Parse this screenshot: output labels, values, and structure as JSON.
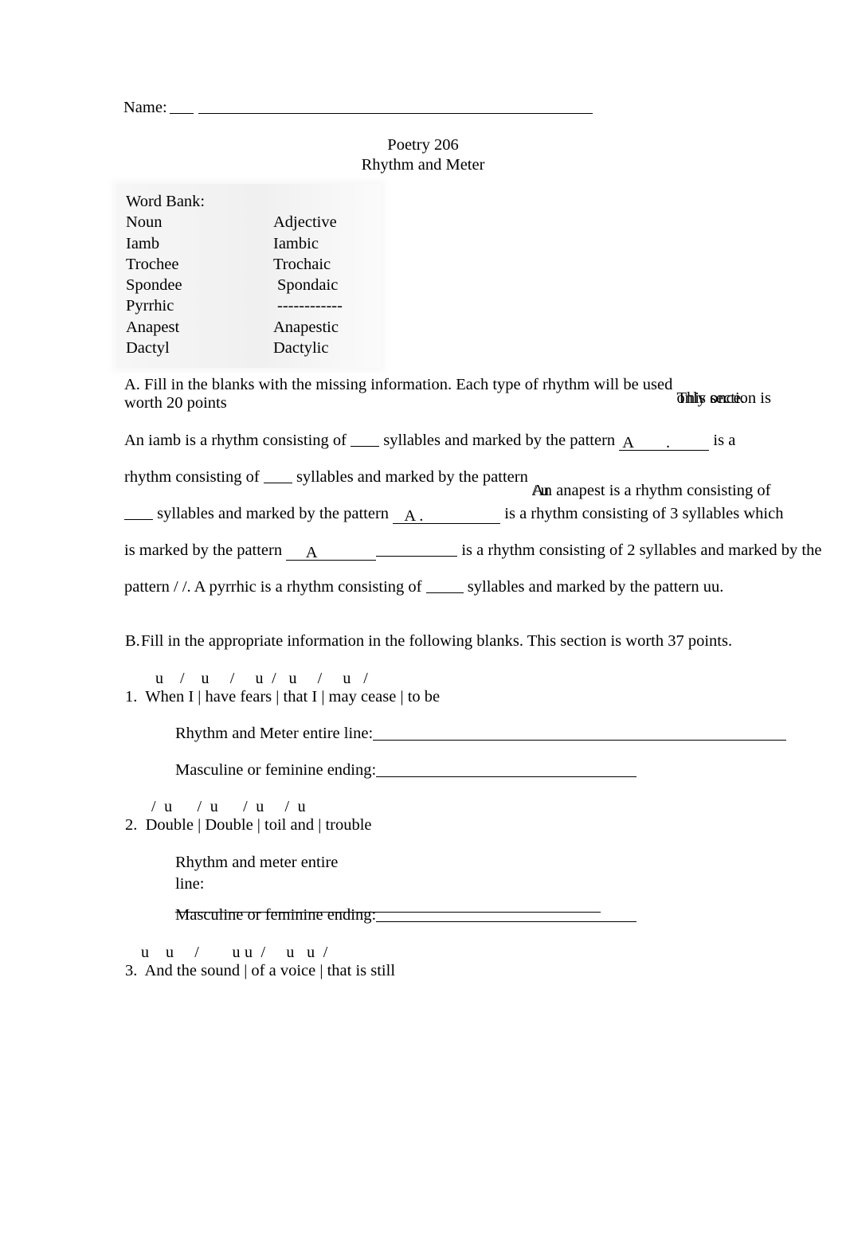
{
  "document": {
    "name_label": "Name:",
    "title_line1": "Poetry 206",
    "title_line2": "Rhythm and Meter"
  },
  "word_bank": {
    "heading": "Word Bank:",
    "rows": [
      {
        "noun": "Noun",
        "adjective": "Adjective"
      },
      {
        "noun": "Iamb",
        "adjective": "Iambic"
      },
      {
        "noun": "Trochee",
        "adjective": "Trochaic"
      },
      {
        "noun": "Spondee",
        "adjective": "Spondaic"
      },
      {
        "noun": "Pyrrhic",
        "adjective": "------------"
      },
      {
        "noun": "Anapest",
        "adjective": "Anapestic"
      },
      {
        "noun": "Dactyl",
        "adjective": "Dactylic"
      }
    ]
  },
  "section_a": {
    "instructions_part1": "A.  Fill in the blanks with the missing information. Each type of rhythm will be used ",
    "instructions_overlap_a": "only once.",
    "instructions_overlap_b": "This section is",
    "instructions_part2": "worth 20 points",
    "line1_t1": "An iamb is a rhythm consisting of ",
    "line1_t2": " syllables and marked by the pattern ",
    "line1_answer": " A        .",
    "line1_t3": " is a",
    "line2_t1": "rhythm consisting of ",
    "line2_t2": " syllables and marked by the pattern ",
    "line2_overlap_a": "/ u",
    "line2_overlap_b": "An anapest is a rhythm consisting of",
    "line3_t1": " syllables and marked by the pattern ",
    "line3_answer": "   A .",
    "line3_t2": " is a rhythm consisting of 3 syllables which",
    "line4_t1": "is marked by the pattern ",
    "line4_answer": "     A",
    "line4_t2": " is a rhythm consisting of 2 syllables and marked by the",
    "line5_t1": "pattern / /. A pyrrhic is a rhythm consisting of ",
    "line5_t2": " syllables and marked by the pattern uu."
  },
  "section_b": {
    "letter": "B.",
    "instructions": "Fill in the appropriate information in the following blanks. This section is worth 37 points.",
    "items": [
      {
        "scansion": "u    /    u     /     u  /   u     /     u   /",
        "text": "1.  When I | have fears | that I | may cease | to be",
        "prompt_rhythm": "Rhythm and Meter entire line:",
        "prompt_ending": "Masculine or feminine ending:"
      },
      {
        "scansion": "/  u      /  u      /  u     /  u",
        "text": "2.  Double | Double | toil and | trouble",
        "prompt_rhythm_line1": "Rhythm and meter entire",
        "prompt_rhythm_line2": "line:",
        "prompt_ending": "Masculine or feminine ending:"
      },
      {
        "scansion": "u    u     /        u u  /     u   u  /",
        "text": "3.  And the sound | of a voice | that is still"
      }
    ]
  }
}
